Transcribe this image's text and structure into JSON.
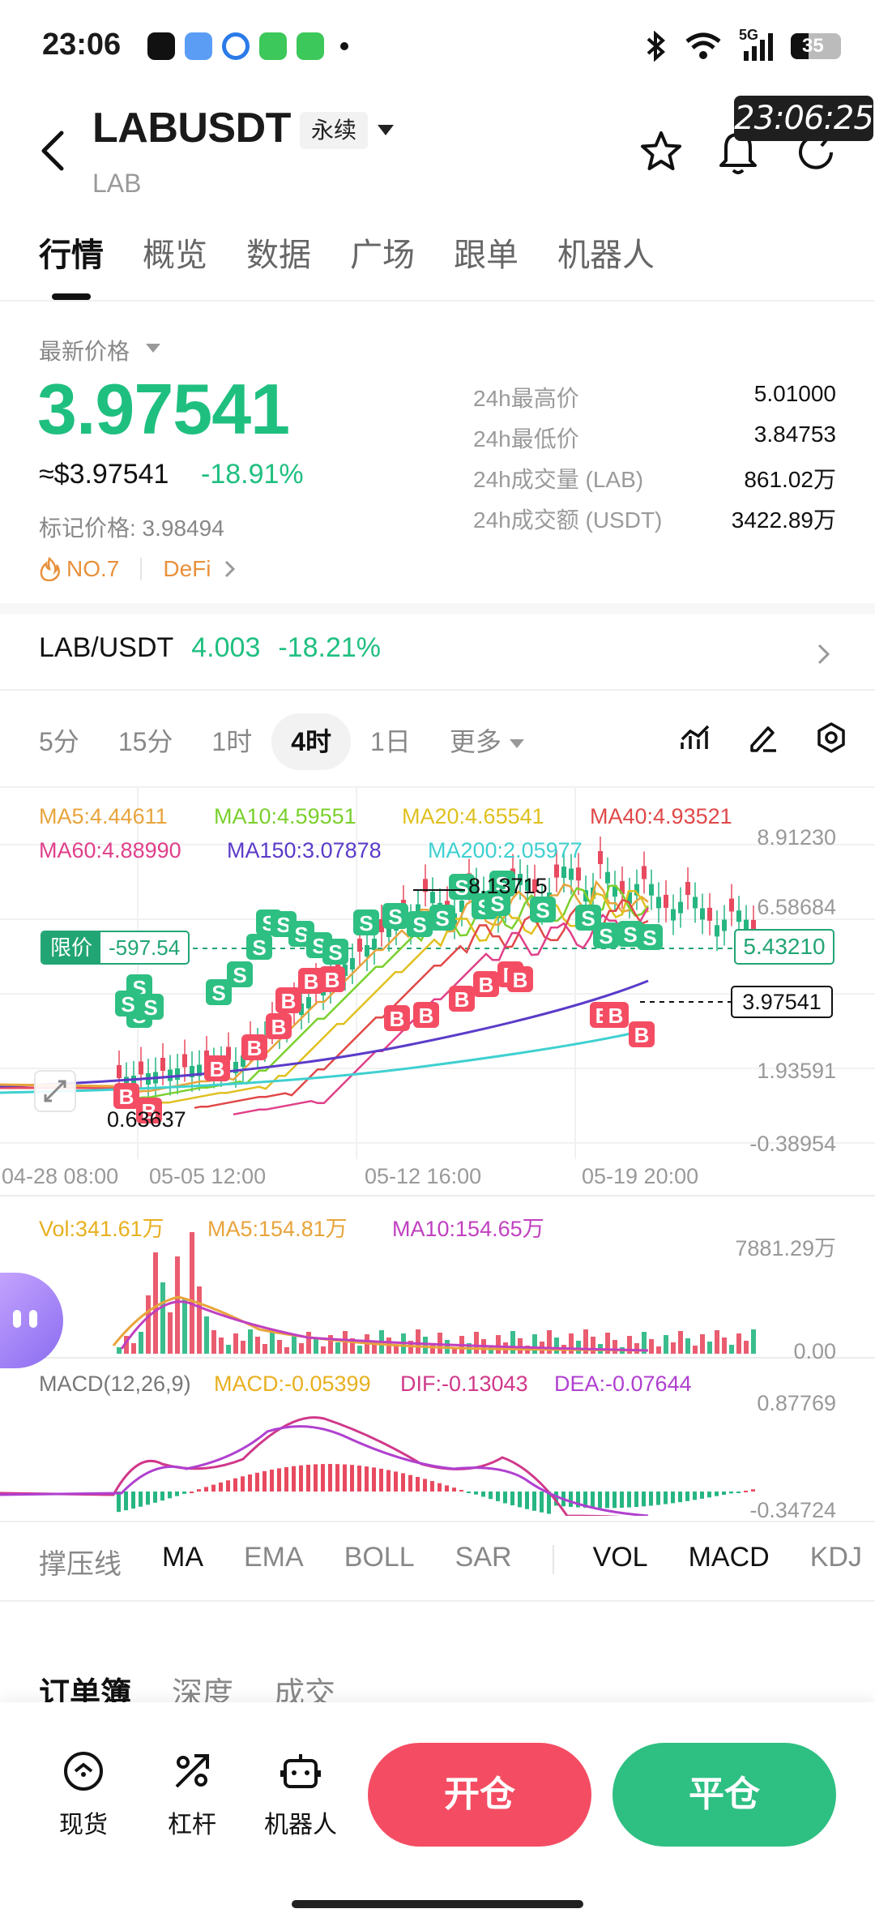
{
  "status_bar": {
    "time": "23:06",
    "network": "5G",
    "battery": "35"
  },
  "header": {
    "pair": "LABUSDT",
    "contract_type": "永续",
    "base": "LAB",
    "time_badge": "23:06:25"
  },
  "tabs": [
    "行情",
    "概览",
    "数据",
    "广场",
    "跟单",
    "机器人"
  ],
  "price": {
    "latest_label": "最新价格",
    "last": "3.97541",
    "usd": "≈$3.97541",
    "change_pct": "-18.91%",
    "mark": "标记价格: 3.98494",
    "rank": "NO.7",
    "sector": "DeFi"
  },
  "stats": [
    {
      "label": "24h最高价",
      "value": "5.01000"
    },
    {
      "label": "24h最低价",
      "value": "3.84753"
    },
    {
      "label": "24h成交量 (LAB)",
      "value": "861.02万"
    },
    {
      "label": "24h成交额 (USDT)",
      "value": "3422.89万"
    }
  ],
  "spot": {
    "pair": "LAB/USDT",
    "price": "4.003",
    "change": "-18.21%"
  },
  "timeframes": [
    "5分",
    "15分",
    "1时",
    "4时",
    "1日",
    "更多"
  ],
  "chart": {
    "ma_row1": [
      {
        "text": "MA5:4.44611",
        "color": "#e8a43c"
      },
      {
        "text": "MA10:4.59551",
        "color": "#7ad02d"
      },
      {
        "text": "MA20:4.65541",
        "color": "#e0c020"
      },
      {
        "text": "MA40:4.93521",
        "color": "#e04848"
      }
    ],
    "ma_row2": [
      {
        "text": "MA60:4.88990",
        "color": "#e0408a"
      },
      {
        "text": "MA150:3.07878",
        "color": "#5b3bc9"
      },
      {
        "text": "MA200:2.05977",
        "color": "#3fd0d0"
      }
    ],
    "high_marker": "8.13715",
    "low_marker": "0.63637",
    "limit_label": "限价",
    "limit_value": "-597.54",
    "limit_price": "5.43210",
    "current_price": "3.97541",
    "y_axis": [
      "8.91230",
      "6.58684",
      "1.93591",
      "-0.38954"
    ],
    "x_axis": [
      "04-28 08:00",
      "05-05 12:00",
      "05-12 16:00",
      "05-19 20:00"
    ],
    "vol_legend": [
      {
        "text": "Vol:341.61万",
        "color": "#e8b020"
      },
      {
        "text": "MA5:154.81万",
        "color": "#e8a43c"
      },
      {
        "text": "MA10:154.65万",
        "color": "#c040c0"
      }
    ],
    "vol_axis": [
      "7881.29万",
      "0.00"
    ],
    "macd_legend": [
      {
        "text": "MACD(12,26,9)",
        "color": "#777777"
      },
      {
        "text": "MACD:-0.05399",
        "color": "#e8b020"
      },
      {
        "text": "DIF:-0.13043",
        "color": "#d0388a"
      },
      {
        "text": "DEA:-0.07644",
        "color": "#b040d0"
      }
    ],
    "macd_axis": [
      "0.87769",
      "-0.34724"
    ]
  },
  "indicators_main": [
    "撑压线",
    "MA",
    "EMA",
    "BOLL",
    "SAR"
  ],
  "indicators_sub": [
    "VOL",
    "MACD",
    "KDJ"
  ],
  "orderbook_tabs": [
    "订单簿",
    "深度",
    "成交"
  ],
  "bottom": {
    "spot": "现货",
    "leverage": "杠杆",
    "robot": "机器人",
    "open": "开仓",
    "close": "平仓"
  },
  "colors": {
    "up": "#1fbf80",
    "down": "#f44d63",
    "accent": "#2ebf83"
  }
}
